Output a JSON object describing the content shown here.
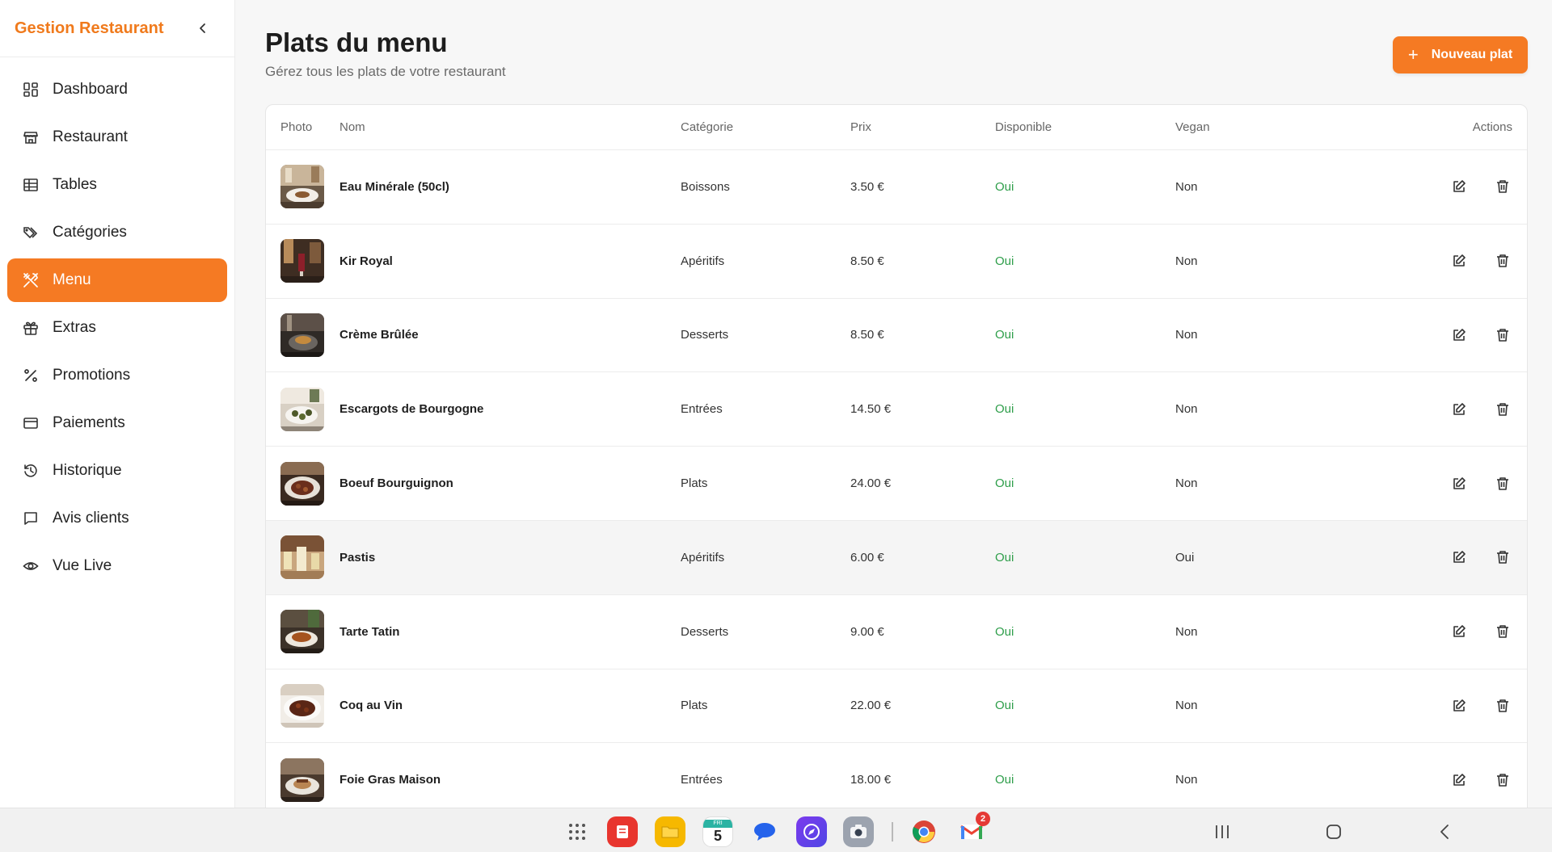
{
  "sidebar": {
    "brand": "Gestion Restaurant",
    "items": [
      {
        "label": "Dashboard",
        "icon": "dashboard-icon"
      },
      {
        "label": "Restaurant",
        "icon": "store-icon"
      },
      {
        "label": "Tables",
        "icon": "table-grid-icon"
      },
      {
        "label": "Catégories",
        "icon": "tags-icon"
      },
      {
        "label": "Menu",
        "icon": "utensils-icon",
        "active": true
      },
      {
        "label": "Extras",
        "icon": "gift-icon"
      },
      {
        "label": "Promotions",
        "icon": "percent-icon"
      },
      {
        "label": "Paiements",
        "icon": "credit-card-icon"
      },
      {
        "label": "Historique",
        "icon": "history-icon"
      },
      {
        "label": "Avis clients",
        "icon": "message-icon"
      },
      {
        "label": "Vue Live",
        "icon": "eye-icon"
      }
    ]
  },
  "header": {
    "title": "Plats du menu",
    "subtitle": "Gérez tous les plats de votre restaurant",
    "new_button": "Nouveau plat",
    "new_button_icon": "+"
  },
  "table": {
    "columns": [
      "Photo",
      "Nom",
      "Catégorie",
      "Prix",
      "Disponible",
      "Vegan",
      "Actions"
    ],
    "rows": [
      {
        "nom": "Eau Minérale (50cl)",
        "categorie": "Boissons",
        "prix": "3.50 €",
        "disponible": "Oui",
        "vegan": "Non"
      },
      {
        "nom": "Kir Royal",
        "categorie": "Apéritifs",
        "prix": "8.50 €",
        "disponible": "Oui",
        "vegan": "Non"
      },
      {
        "nom": "Crème Brûlée",
        "categorie": "Desserts",
        "prix": "8.50 €",
        "disponible": "Oui",
        "vegan": "Non"
      },
      {
        "nom": "Escargots de Bourgogne",
        "categorie": "Entrées",
        "prix": "14.50 €",
        "disponible": "Oui",
        "vegan": "Non"
      },
      {
        "nom": "Boeuf Bourguignon",
        "categorie": "Plats",
        "prix": "24.00 €",
        "disponible": "Oui",
        "vegan": "Non"
      },
      {
        "nom": "Pastis",
        "categorie": "Apéritifs",
        "prix": "6.00 €",
        "disponible": "Oui",
        "vegan": "Oui"
      },
      {
        "nom": "Tarte Tatin",
        "categorie": "Desserts",
        "prix": "9.00 €",
        "disponible": "Oui",
        "vegan": "Non"
      },
      {
        "nom": "Coq au Vin",
        "categorie": "Plats",
        "prix": "22.00 €",
        "disponible": "Oui",
        "vegan": "Non"
      },
      {
        "nom": "Foie Gras Maison",
        "categorie": "Entrées",
        "prix": "18.00 €",
        "disponible": "Oui",
        "vegan": "Non"
      }
    ]
  },
  "taskbar": {
    "calendar_day": "5",
    "calendar_label": "FRI",
    "gmail_badge": "2"
  },
  "colors": {
    "accent": "#f57a23",
    "brand": "#f07a1c",
    "available": "#2e9e4a"
  }
}
